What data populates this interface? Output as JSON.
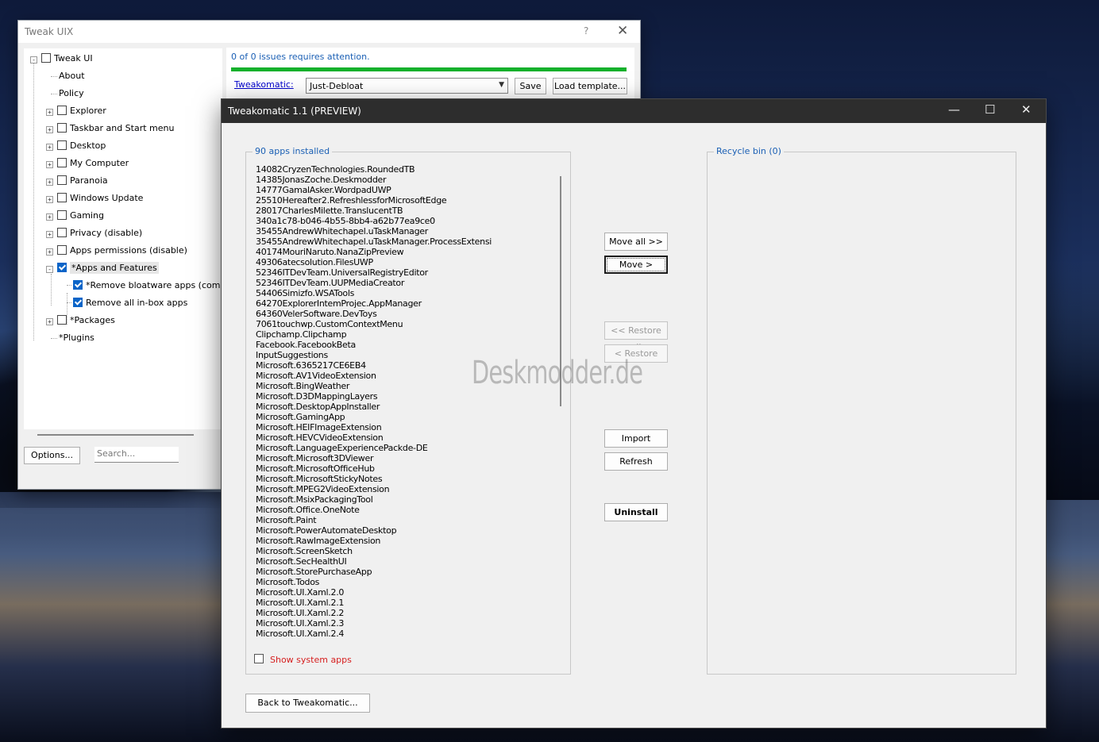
{
  "tweak_uix": {
    "title": "Tweak UIX",
    "help_glyph": "?",
    "close_glyph": "✕",
    "tree": [
      {
        "label": "Tweak UI",
        "checked": false
      },
      {
        "label": "About"
      },
      {
        "label": "Policy"
      },
      {
        "label": "Explorer",
        "checked": false
      },
      {
        "label": "Taskbar and Start menu",
        "checked": false
      },
      {
        "label": "Desktop",
        "checked": false
      },
      {
        "label": "My Computer",
        "checked": false
      },
      {
        "label": "Paranoia",
        "checked": false
      },
      {
        "label": "Windows Update",
        "checked": false
      },
      {
        "label": "Gaming",
        "checked": false
      },
      {
        "label": "Privacy (disable)",
        "checked": false
      },
      {
        "label": "Apps permissions (disable)",
        "checked": false
      },
      {
        "label": "*Apps and Features",
        "checked": true
      },
      {
        "label": "*Remove bloatware apps (community",
        "checked": true
      },
      {
        "label": "Remove all in-box apps",
        "checked": true
      },
      {
        "label": "*Packages",
        "checked": false
      },
      {
        "label": "*Plugins"
      }
    ],
    "options_label": "Options...",
    "search_placeholder": "Search...",
    "issues_text": "0 of 0 issues requires attention.",
    "progress": 1.0,
    "tweakomatic_link": "Tweakomatic:",
    "template_value": "Just-Debloat",
    "save_label": "Save",
    "load_template_label": "Load template..."
  },
  "tweakomatic": {
    "title": "Tweakomatic 1.1 (PREVIEW)",
    "installed_label": "90 apps installed",
    "recycle_label": "Recycle bin (0)",
    "apps": [
      "14082CryzenTechnologies.RoundedTB",
      "14385JonasZoche.Deskmodder",
      "14777GamalAsker.WordpadUWP",
      "25510Hereafter2.RefreshlessforMicrosoftEdge",
      "28017CharlesMilette.TranslucentTB",
      "340a1c78-b046-4b55-8bb4-a62b77ea9ce0",
      "35455AndrewWhitechapel.uTaskManager",
      "35455AndrewWhitechapel.uTaskManager.ProcessExtensi",
      "40174MouriNaruto.NanaZipPreview",
      "49306atecsolution.FilesUWP",
      "52346ITDevTeam.UniversalRegistryEditor",
      "52346ITDevTeam.UUPMediaCreator",
      "54406Simizfo.WSATools",
      "64270ExplorerIntemProjec.AppManager",
      "64360VelerSoftware.DevToys",
      "7061touchwp.CustomContextMenu",
      "Clipchamp.Clipchamp",
      "Facebook.FacebookBeta",
      "InputSuggestions",
      "Microsoft.6365217CE6EB4",
      "Microsoft.AV1VideoExtension",
      "Microsoft.BingWeather",
      "Microsoft.D3DMappingLayers",
      "Microsoft.DesktopAppInstaller",
      "Microsoft.GamingApp",
      "Microsoft.HEIFImageExtension",
      "Microsoft.HEVCVideoExtension",
      "Microsoft.LanguageExperiencePackde-DE",
      "Microsoft.Microsoft3DViewer",
      "Microsoft.MicrosoftOfficeHub",
      "Microsoft.MicrosoftStickyNotes",
      "Microsoft.MPEG2VideoExtension",
      "Microsoft.MsixPackagingTool",
      "Microsoft.Office.OneNote",
      "Microsoft.Paint",
      "Microsoft.PowerAutomateDesktop",
      "Microsoft.RawImageExtension",
      "Microsoft.ScreenSketch",
      "Microsoft.SecHealthUI",
      "Microsoft.StorePurchaseApp",
      "Microsoft.Todos",
      "Microsoft.UI.Xaml.2.0",
      "Microsoft.UI.Xaml.2.1",
      "Microsoft.UI.Xaml.2.2",
      "Microsoft.UI.Xaml.2.3",
      "Microsoft.UI.Xaml.2.4"
    ],
    "show_system_apps_label": "Show system apps",
    "move_all_label": "Move all >>",
    "move_label": "Move >",
    "restore_all_label": "<< Restore all",
    "restore_label": "< Restore",
    "import_label": "Import",
    "refresh_label": "Refresh",
    "uninstall_label": "Uninstall",
    "back_label": "Back to Tweakomatic...",
    "watermark": "Deskmodder.de",
    "minimize_glyph": "—",
    "maximize_glyph": "☐",
    "close_glyph": "✕"
  }
}
